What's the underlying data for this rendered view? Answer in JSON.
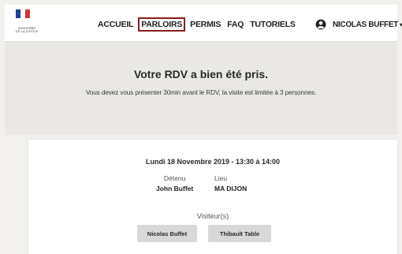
{
  "header": {
    "logo_caption": "MINISTÈRE\nDE LA JUSTICE",
    "flag_colors": [
      "#1f3f95",
      "#ffffff",
      "#d0343b"
    ],
    "nav": [
      {
        "label": "ACCUEIL",
        "active": false
      },
      {
        "label": "PARLOIRS",
        "active": true
      },
      {
        "label": "PERMIS",
        "active": false
      },
      {
        "label": "FAQ",
        "active": false
      },
      {
        "label": "TUTORIELS",
        "active": false
      }
    ],
    "active_border_color": "#8a1c1c",
    "user_icon": "account-circle-icon",
    "user_name": "NICOLAS BUFFET",
    "user_caret": "▾"
  },
  "confirmation": {
    "title": "Votre RDV a bien été pris.",
    "message": "Vous devez vous présenter 30min avant le RDV, la visite est limitée à 3 personnes."
  },
  "appointment": {
    "datetime": "Lundi 18 Novembre 2019 - 13:30 à 14:00",
    "detenu_label": "Détenu",
    "detenu_value": "John Buffet",
    "lieu_label": "Lieu",
    "lieu_value": "MA DIJON",
    "visitors_label": "Visiteur(s)",
    "visitors": [
      "Nicolas Buffet",
      "Thibault Table"
    ]
  }
}
